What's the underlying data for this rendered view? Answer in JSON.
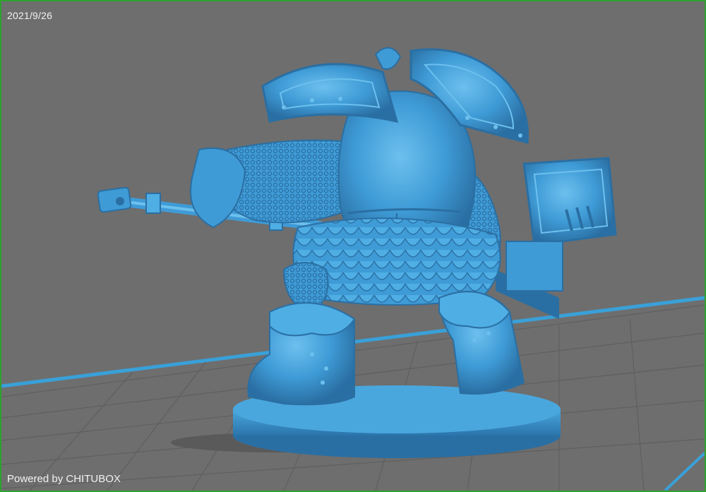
{
  "viewport": {
    "date": "2021/9/26",
    "powered_by": "Powered by CHITUBOX"
  },
  "colors": {
    "frame": "#2ea12e",
    "background": "#6e6e6e",
    "grid": "#5c5c5c",
    "build_plate_edge": "#3aa0d8",
    "model": "#3f9bd6",
    "model_shadow": "#2a6fa3",
    "model_highlight": "#6cc0ee"
  },
  "model": {
    "icon": "miniature-warrior-model"
  }
}
